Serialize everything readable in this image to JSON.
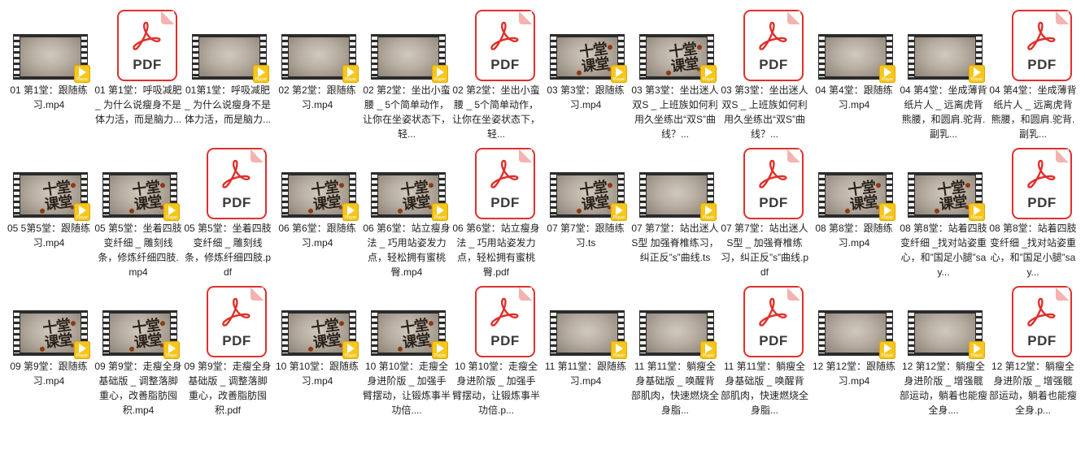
{
  "badge": {
    "label": "Player"
  },
  "pdf_icon": {
    "label": "PDF"
  },
  "video_brand": {
    "line1": "十堂",
    "line2": "课堂"
  },
  "rows": [
    [
      {
        "type": "video",
        "style": "plain",
        "label": "01 第1堂：跟随练习.mp4"
      },
      {
        "type": "pdf",
        "label": "01 第1堂：呼吸减肥 _ 为什么说瘦身不是体力活，而是脑力..."
      },
      {
        "type": "video",
        "style": "plain",
        "label": "01第1堂：呼吸减肥 _ 为什么说瘦身不是体力活，而是脑力..."
      },
      {
        "type": "video",
        "style": "plain",
        "label": "02 第2堂：跟随练习.mp4"
      },
      {
        "type": "video",
        "style": "plain",
        "label": "02 第2堂：坐出小蛮腰 _ 5个简单动作，让你在坐姿状态下，轻..."
      },
      {
        "type": "pdf",
        "label": "02 第2堂：坐出小蛮腰 _ 5个简单动作，让你在坐姿状态下，轻..."
      },
      {
        "type": "video",
        "style": "brand",
        "label": "03 第3堂：跟随练习.mp4"
      },
      {
        "type": "video",
        "style": "brand",
        "label": "03 第3堂：坐出迷人双S _ 上班族如何利用久坐练出“双S”曲线？..."
      },
      {
        "type": "pdf",
        "label": "03 第3堂：坐出迷人双S _ 上班族如何利用久坐练出“双S”曲线？..."
      },
      {
        "type": "video",
        "style": "plain",
        "label": "04 第4堂：跟随练习.mp4"
      },
      {
        "type": "video",
        "style": "plain",
        "label": "04 第4堂：坐成薄背纸片人 _ 远离虎背熊腰，和圆肩.驼背.副乳..."
      },
      {
        "type": "pdf",
        "label": "04 第4堂：坐成薄背纸片人 _ 远离虎背熊腰，和圆肩.驼背.副乳..."
      }
    ],
    [
      {
        "type": "video",
        "style": "brand",
        "label": "05 5第5堂：跟随练习.mp4"
      },
      {
        "type": "video",
        "style": "brand",
        "label": "05 第5堂：坐着四肢变纤细 _ 雕刻线条，修炼纤细四肢.mp4"
      },
      {
        "type": "pdf",
        "label": "05 第5堂：坐着四肢变纤细 _ 雕刻线条，修炼纤细四肢.pdf"
      },
      {
        "type": "video",
        "style": "brand",
        "label": "06 第6堂：跟随练习.mp4"
      },
      {
        "type": "video",
        "style": "brand",
        "label": "06 第6堂：站立瘦身法 _ 巧用站姿发力点，轻松拥有蜜桃臀.mp4"
      },
      {
        "type": "pdf",
        "label": "06 第6堂：站立瘦身法 _ 巧用站姿发力点，轻松拥有蜜桃臀.pdf"
      },
      {
        "type": "video",
        "style": "brand",
        "label": "07 第7堂：跟随练习.ts"
      },
      {
        "type": "video",
        "style": "plain",
        "label": "07 第7堂：站出迷人S型  加强脊椎练习，纠正反”s”曲线.ts"
      },
      {
        "type": "pdf",
        "label": "07 第7堂：站出迷人S型 _ 加强脊椎练习，纠正反”s”曲线.pdf"
      },
      {
        "type": "video",
        "style": "brand",
        "label": "08 第8堂：跟随练习.mp4"
      },
      {
        "type": "video",
        "style": "brand",
        "label": "08 第8堂：站着四肢变纤细 _找对站姿重心，和”国足小腿”say..."
      },
      {
        "type": "pdf",
        "label": "08 第8堂：站着四肢变纤细 _找对站姿重心，和”国足小腿”say..."
      }
    ],
    [
      {
        "type": "video",
        "style": "brand",
        "label": "09 第9堂：跟随练习.mp4"
      },
      {
        "type": "video",
        "style": "brand",
        "label": "09 第9堂：走瘦全身基础版 _ 调整落脚重心，改善脂肪囤积.mp4"
      },
      {
        "type": "pdf",
        "label": "09 第9堂：走瘦全身基础版 _ 调整落脚重心，改善脂肪囤积.pdf"
      },
      {
        "type": "video",
        "style": "brand",
        "label": "10 第10堂：跟随练习.mp4"
      },
      {
        "type": "video",
        "style": "brand",
        "label": "10 第10堂：走瘦全身进阶版 _ 加强手臂摆动，让锻炼事半功倍...."
      },
      {
        "type": "pdf",
        "label": "10 第10堂：走瘦全身进阶版 _ 加强手臂摆动，让锻炼事半功倍.p..."
      },
      {
        "type": "video",
        "style": "plain",
        "label": "11 第11堂：跟随练习.mp4"
      },
      {
        "type": "video",
        "style": "plain",
        "label": "11 第11堂：躺瘦全身基础版 _ 唤醒背部肌肉，快速燃烧全身脂..."
      },
      {
        "type": "pdf",
        "label": "11 第11堂：躺瘦全身基础版 _ 唤醒背部肌肉，快速燃烧全身脂..."
      },
      {
        "type": "video",
        "style": "plain",
        "label": "12 第12堂：跟随练习.mp4"
      },
      {
        "type": "video",
        "style": "plain",
        "label": "12 第12堂：躺瘦全身进阶版 _ 增强髋部运动，躺着也能瘦全身...."
      },
      {
        "type": "pdf",
        "label": "12 第12堂：躺瘦全身进阶版 _ 增强髋部运动，躺着也能瘦全身.p..."
      }
    ]
  ]
}
